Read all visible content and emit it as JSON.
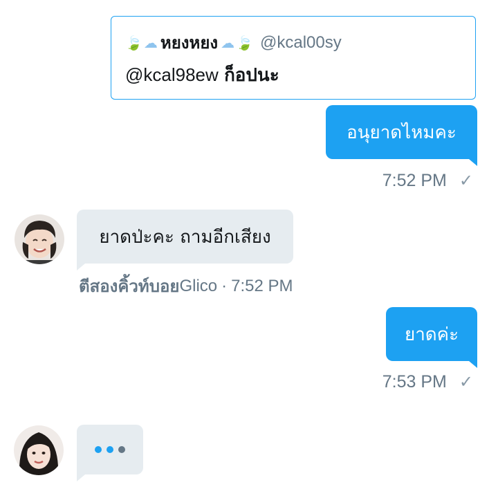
{
  "quote": {
    "leaf_icon": "🍃",
    "cloud_icon": "☁",
    "display_name": "หยงหยง",
    "handle": "@kcal00sy",
    "mention": "@kcal98ew",
    "text": "ก็อปนะ"
  },
  "messages": [
    {
      "id": "out-1",
      "direction": "outgoing",
      "text": "อนุยาดไหมคะ",
      "time": "7:52 PM",
      "status_icon": "✓"
    },
    {
      "id": "in-1",
      "direction": "incoming",
      "text": "ยาดป่ะคะ ถามอีกเสียง",
      "sender_bold": "ตีสองคิ้วท์บอย",
      "sender_tail": "Glico",
      "separator": "·",
      "time": "7:52 PM"
    },
    {
      "id": "out-2",
      "direction": "outgoing",
      "text": "ยาดค่ะ",
      "time": "7:53 PM",
      "status_icon": "✓"
    },
    {
      "id": "in-typing",
      "direction": "incoming",
      "typing": true
    }
  ],
  "colors": {
    "accent": "#1da1f2",
    "incoming_bubble": "#e6ecf0",
    "meta_text": "#657786",
    "typing_dot_active": "#1da1f2",
    "typing_dot_idle": "#657786"
  }
}
